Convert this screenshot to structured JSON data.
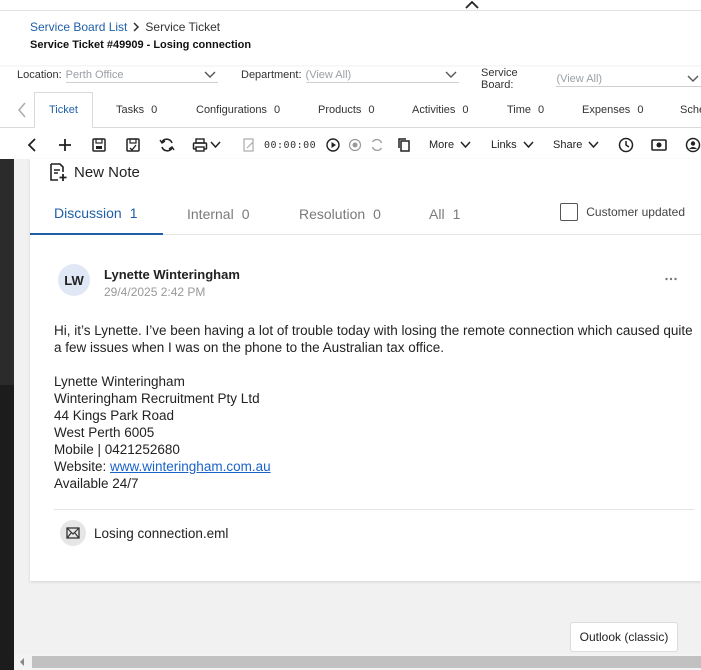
{
  "breadcrumb": {
    "parent": "Service Board List",
    "current": "Service Ticket"
  },
  "ticket_title": "Service Ticket #49909 - Losing connection",
  "filters": [
    {
      "label": "Location:",
      "value": "Perth Office"
    },
    {
      "label": "Department:",
      "value": "(View All)"
    },
    {
      "label": "Service Board:",
      "value": "(View All)"
    }
  ],
  "tabs": [
    {
      "label": "Ticket",
      "count": ""
    },
    {
      "label": "Tasks",
      "count": "0"
    },
    {
      "label": "Configurations",
      "count": "0"
    },
    {
      "label": "Products",
      "count": "0"
    },
    {
      "label": "Activities",
      "count": "0"
    },
    {
      "label": "Time",
      "count": "0"
    },
    {
      "label": "Expenses",
      "count": "0"
    },
    {
      "label": "Sche",
      "count": ""
    }
  ],
  "toolbar": {
    "timer": "00:00:00",
    "more_label": "More",
    "links_label": "Links",
    "share_label": "Share"
  },
  "new_note_label": "New Note",
  "discussion_tabs": [
    {
      "label": "Discussion",
      "count": "1"
    },
    {
      "label": "Internal",
      "count": "0"
    },
    {
      "label": "Resolution",
      "count": "0"
    },
    {
      "label": "All",
      "count": "1"
    }
  ],
  "customer_updated_label": "Customer updated",
  "note": {
    "initials": "LW",
    "author": "Lynette Winteringham",
    "date": "29/4/2025 2:42 PM",
    "message": "Hi, it’s Lynette. I’ve been having a lot of trouble today with losing the remote connection which caused quite a few issues when I was on the phone to the Australian tax office.",
    "signature": [
      "Lynette Winteringham",
      "Winteringham Recruitment Pty Ltd",
      "44 Kings Park Road",
      "West Perth 6005",
      "Mobile | 0421252680"
    ],
    "website_label": "Website: ",
    "website": "www.winteringham.com.au",
    "availability": "Available 24/7"
  },
  "attachment": "Losing connection.eml",
  "outlook_button": "Outlook (classic)",
  "colors": {
    "accent": "#1f5fa8",
    "link": "#1a63c9"
  }
}
